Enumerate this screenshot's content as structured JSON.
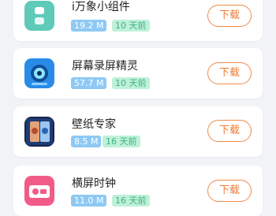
{
  "apps": [
    {
      "title": "i万象小组件",
      "size": "19.2 M",
      "date": "10 天前",
      "button": "下载",
      "icon": "widget-grid-icon"
    },
    {
      "title": "屏幕录屏精灵",
      "size": "57.7 M",
      "date": "10 天前",
      "button": "下载",
      "icon": "screen-record-camera-icon"
    },
    {
      "title": "壁纸专家",
      "size": "8.5 M",
      "date": "16 天前",
      "button": "下载",
      "icon": "wallpaper-icon"
    },
    {
      "title": "横屏时钟",
      "size": "11.0 M",
      "date": "16 天前",
      "button": "下载",
      "icon": "landscape-clock-icon"
    }
  ],
  "colors": {
    "accent": "#f07a36",
    "size_badge": "#8ec9f5",
    "date_badge_bg": "#bff0d9",
    "date_badge_text": "#3fb27f"
  }
}
